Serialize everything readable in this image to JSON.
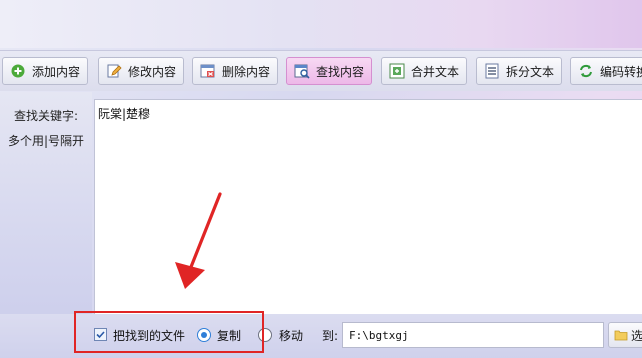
{
  "toolbar": {
    "buttons": [
      {
        "label": "添加内容",
        "icon": "add-icon"
      },
      {
        "label": "修改内容",
        "icon": "edit-icon"
      },
      {
        "label": "删除内容",
        "icon": "delete-icon"
      },
      {
        "label": "查找内容",
        "icon": "find-icon",
        "active": true
      },
      {
        "label": "合并文本",
        "icon": "merge-icon"
      },
      {
        "label": "拆分文本",
        "icon": "split-icon"
      },
      {
        "label": "编码转换",
        "icon": "encode-icon"
      }
    ]
  },
  "sidebar": {
    "keyword_label": "查找关键字:",
    "hint_label": "多个用|号隔开"
  },
  "content": {
    "keywords_value": "阮棠|楚穆"
  },
  "bottom": {
    "checkbox_label": "把找到的文件",
    "checkbox_checked": true,
    "radio_copy_label": "复制",
    "radio_copy_selected": true,
    "radio_move_label": "移动",
    "to_label": "到:",
    "path_value": "F:\\bgtxgj",
    "browse_label": "选"
  },
  "colors": {
    "highlight": "#e02525",
    "active_button": "#edb8e8",
    "radio_accent": "#2f7fd8"
  }
}
